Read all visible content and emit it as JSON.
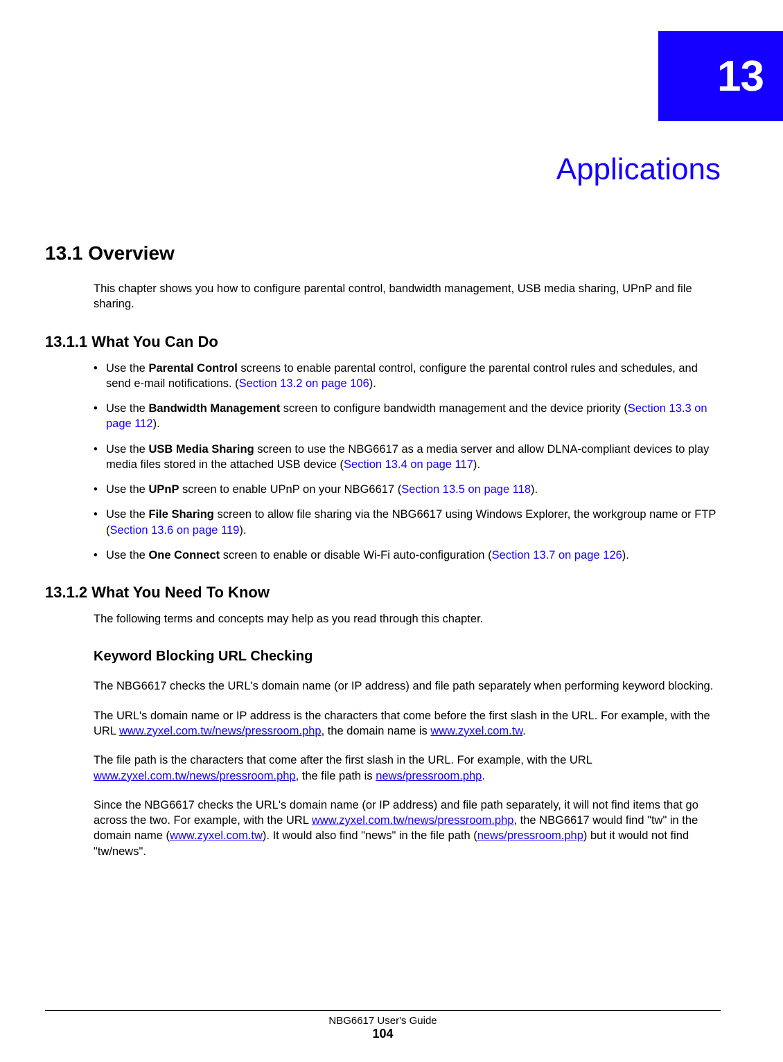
{
  "chapter": {
    "number": "13",
    "title": "Applications"
  },
  "section_overview": {
    "heading": "13.1  Overview",
    "intro": "This chapter shows you how to configure parental control, bandwidth management, USB media sharing, UPnP and file sharing."
  },
  "what_you_can_do": {
    "heading": "13.1.1  What You Can Do",
    "items": [
      {
        "pre": "Use the ",
        "bold": "Parental Control",
        "post": " screens to enable parental control, configure the parental control rules and schedules, and send e-mail notifications. (",
        "xref": "Section 13.2 on page 106",
        "tail": ")."
      },
      {
        "pre": "Use the ",
        "bold": "Bandwidth Management",
        "post": " screen to configure bandwidth management and the device priority (",
        "xref": "Section 13.3 on page 112",
        "tail": ")."
      },
      {
        "pre": "Use the ",
        "bold": "USB Media Sharing",
        "post": " screen to use the NBG6617 as a media server and allow DLNA-compliant devices to play media files stored in the attached USB device (",
        "xref": "Section 13.4 on page 117",
        "tail": ")."
      },
      {
        "pre": "Use the ",
        "bold": "UPnP",
        "post": " screen to enable UPnP on your NBG6617 (",
        "xref": "Section 13.5 on page 118",
        "tail": ")."
      },
      {
        "pre": "Use the ",
        "bold": "File Sharing",
        "post": " screen to allow file sharing via the NBG6617 using Windows Explorer, the workgroup name or FTP (",
        "xref": "Section 13.6 on page 119",
        "tail": ")."
      },
      {
        "pre": "Use the ",
        "bold": "One Connect",
        "post": " screen to enable or disable Wi-Fi auto-configuration (",
        "xref": "Section 13.7 on page 126",
        "tail": ")."
      }
    ]
  },
  "need_to_know": {
    "heading": "13.1.2  What You Need To Know",
    "intro": "The following terms and concepts may help as you read through this chapter.",
    "keyword_heading": "Keyword Blocking URL Checking",
    "p1": "The NBG6617 checks the URL's domain name (or IP address) and file path separately when performing keyword blocking.",
    "p2_a": "The URL's domain name or IP address is the characters that come before the first slash in the URL. For example, with the URL ",
    "p2_link1": "www.zyxel.com.tw/news/pressroom.php",
    "p2_b": ", the domain name is ",
    "p2_link2": "www.zyxel.com.tw",
    "p2_c": ".",
    "p3_a": "The file path is the characters that come after the first slash in the URL. For example, with the URL ",
    "p3_link1": "www.zyxel.com.tw/news/pressroom.php",
    "p3_b": ", the file path is ",
    "p3_link2": "news/pressroom.php",
    "p3_c": ".",
    "p4_a": "Since the NBG6617 checks the URL's domain name (or IP address) and file path separately, it will not find items that go across the two. For example, with the URL ",
    "p4_link1": "www.zyxel.com.tw/news/pressroom.php",
    "p4_b": ", the NBG6617 would find \"tw\" in the domain name (",
    "p4_link2": "www.zyxel.com.tw",
    "p4_c": "). It would also find \"news\" in the file path (",
    "p4_link3": "news/pressroom.php",
    "p4_d": ") but it would not find \"tw/news\"."
  },
  "footer": {
    "guide": "NBG6617 User's Guide",
    "page": "104"
  }
}
